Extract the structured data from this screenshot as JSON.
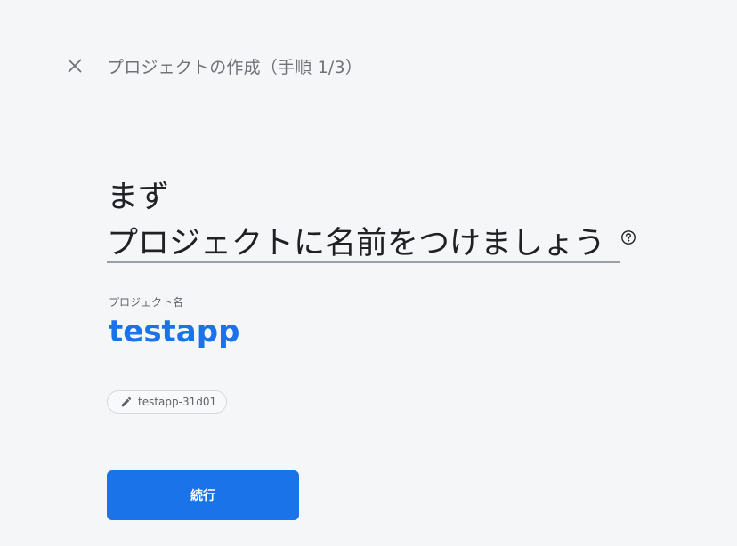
{
  "header": {
    "close_icon": "close-icon",
    "title": "プロジェクトの作成（手順 1/3）"
  },
  "main": {
    "heading_line1": "まず",
    "heading_line2_underlined": "プロジェクト",
    "heading_line2_rest": "に名前をつけましょう",
    "help_icon": "help-circle-icon",
    "field_label": "プロジェクト名",
    "project_name_value": "testapp",
    "project_id_chip": "testapp-31d01",
    "chip_icon": "pencil-icon",
    "continue_label": "続行"
  },
  "colors": {
    "accent": "#1a73e8",
    "background": "#f5f6f8",
    "heading_text": "#202124",
    "muted_text": "#6f7276",
    "underline_gray": "#9aa0a6"
  }
}
